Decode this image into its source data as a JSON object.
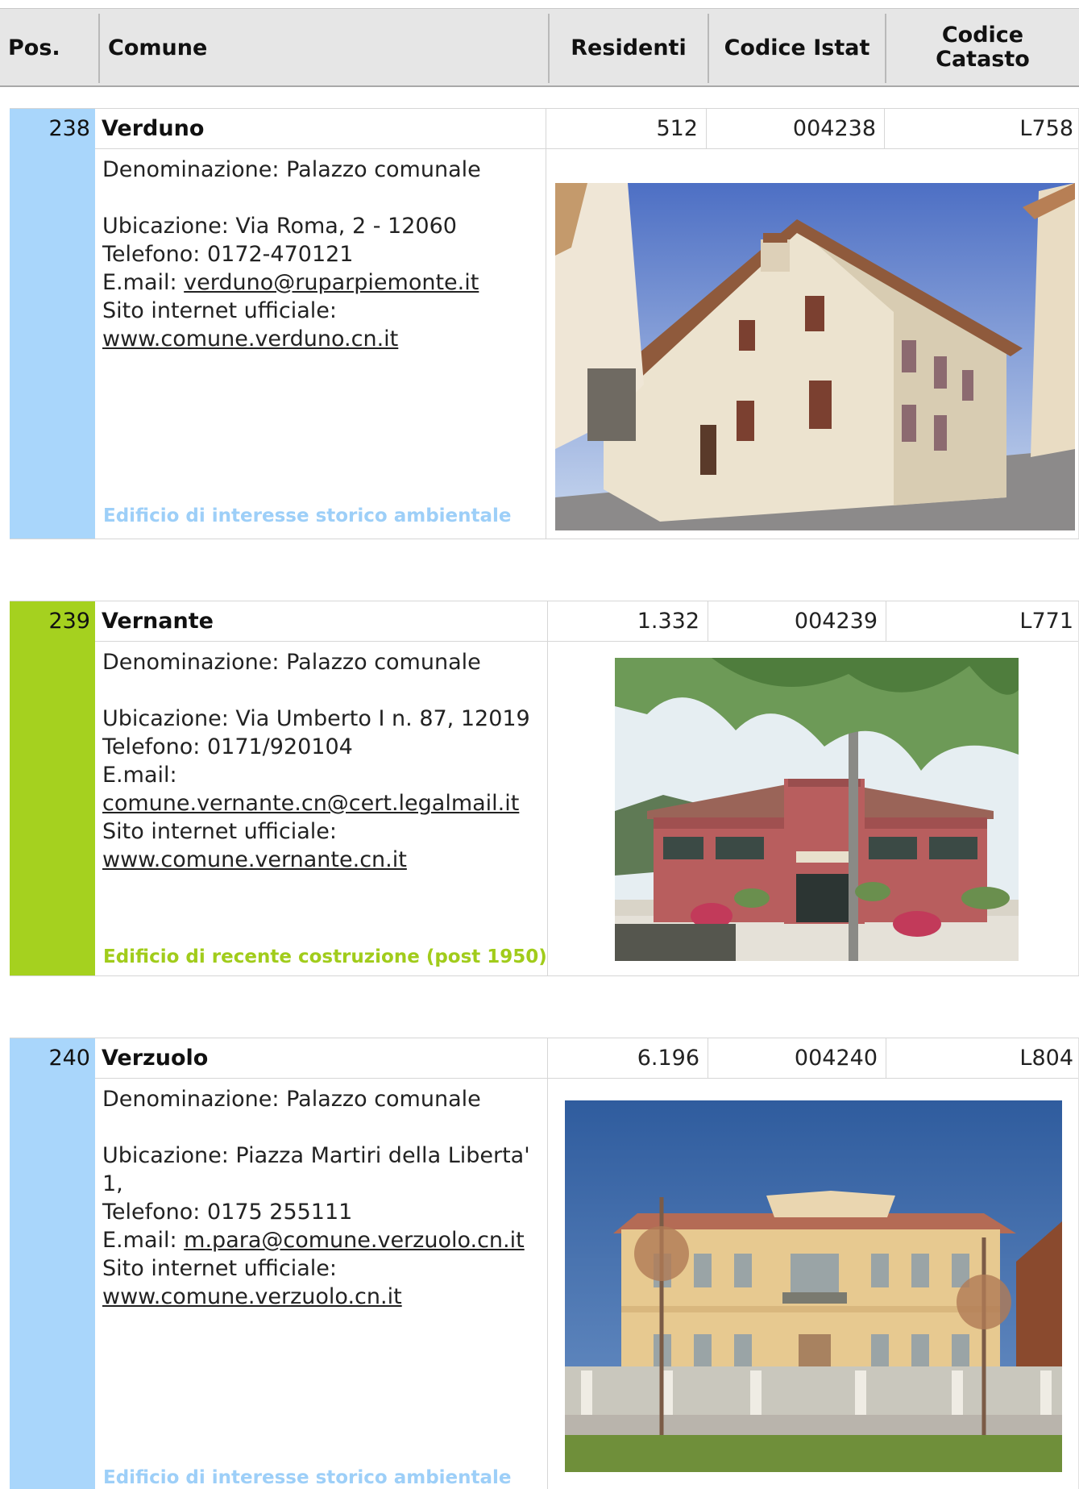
{
  "header": {
    "pos": "Pos.",
    "comune": "Comune",
    "residenti": "Residenti",
    "codice_istat": "Codice Istat",
    "codice_catasto_line1": "Codice",
    "codice_catasto_line2": "Catasto"
  },
  "entries": [
    {
      "pos": "238",
      "name": "Verduno",
      "residenti": "512",
      "istat": "004238",
      "catasto": "L758",
      "denominazione": "Denominazione: Palazzo comunale",
      "ubicazione": "Ubicazione: Via Roma, 2 - 12060",
      "telefono": "Telefono: 0172-470121",
      "email_label": "E.mail: ",
      "email": "verduno@ruparpiemonte.it",
      "sito_label": "Sito internet ufficiale:",
      "sito": "www.comune.verduno.cn.it",
      "note": "Edificio di interesse storico ambientale",
      "category_color": "#a9d6fb",
      "photo": "town-hall-photo"
    },
    {
      "pos": "239",
      "name": "Vernante",
      "residenti": "1.332",
      "istat": "004239",
      "catasto": "L771",
      "denominazione": "Denominazione: Palazzo comunale",
      "ubicazione": "Ubicazione: Via Umberto I n. 87, 12019",
      "telefono": "Telefono: 0171/920104",
      "email_label": "E.mail:",
      "email": "comune.vernante.cn@cert.legalmail.it",
      "sito_label": "Sito internet ufficiale:",
      "sito": "www.comune.vernante.cn.it",
      "note": "Edificio di recente costruzione (post 1950)",
      "category_color": "#a5d11f",
      "photo": "town-hall-photo"
    },
    {
      "pos": "240",
      "name": "Verzuolo",
      "residenti": "6.196",
      "istat": "004240",
      "catasto": "L804",
      "denominazione": "Denominazione: Palazzo comunale",
      "ubicazione_line1": "Ubicazione: Piazza Martiri della Liberta'",
      "ubicazione_line2": "1,",
      "telefono": "Telefono: 0175 255111",
      "email_label": "E.mail: ",
      "email": "m.para@comune.verzuolo.cn.it",
      "sito_label": "Sito internet ufficiale:",
      "sito": "www.comune.verzuolo.cn.it",
      "note": "Edificio di interesse storico ambientale",
      "category_color": "#a9d6fb",
      "photo": "town-hall-photo"
    }
  ]
}
